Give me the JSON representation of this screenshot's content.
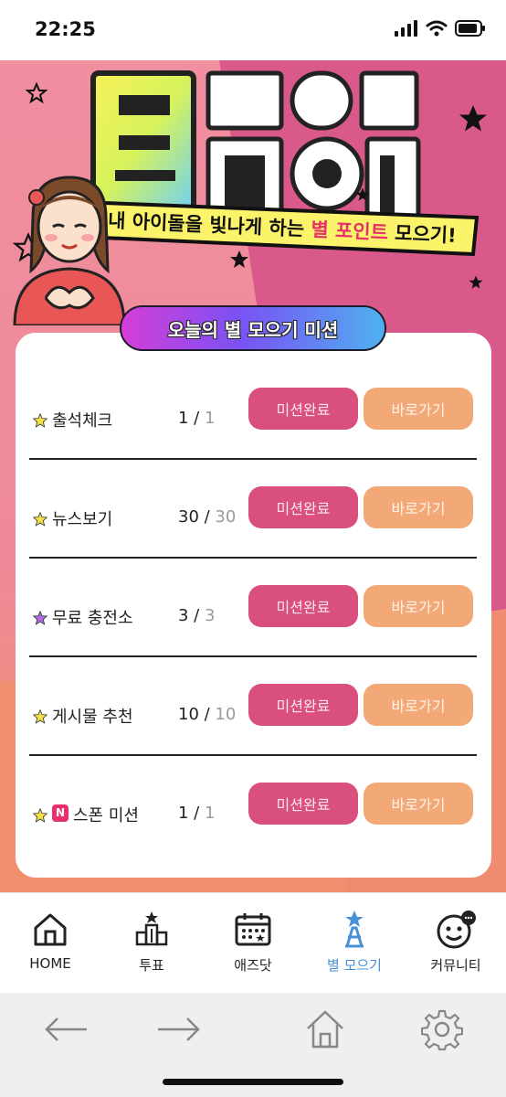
{
  "status": {
    "time": "22:25"
  },
  "hero": {
    "banner_prefix": "내 아이돌을 빛나게 하는",
    "banner_highlight": "별 포인트",
    "banner_suffix": "모으기!",
    "mission_label": "오늘의 별 모으기 미션"
  },
  "missions": [
    {
      "name": "출석체크",
      "current": "1",
      "total": "1",
      "done_label": "미션완료",
      "go_label": "바로가기",
      "star_color": "#f5e04a"
    },
    {
      "name": "뉴스보기",
      "current": "30",
      "total": "30",
      "done_label": "미션완료",
      "go_label": "바로가기",
      "star_color": "#f5e04a"
    },
    {
      "name": "무료 충전소",
      "current": "3",
      "total": "3",
      "done_label": "미션완료",
      "go_label": "바로가기",
      "star_color": "#b06be0"
    },
    {
      "name": "게시물 추천",
      "current": "10",
      "total": "10",
      "done_label": "미션완료",
      "go_label": "바로가기",
      "star_color": "#f5e04a"
    },
    {
      "name": "스폰 미션",
      "badge": "N",
      "current": "1",
      "total": "1",
      "done_label": "미션완료",
      "go_label": "바로가기",
      "star_color": "#f5e04a"
    }
  ],
  "tabs": [
    {
      "label": "HOME",
      "icon": "home-icon"
    },
    {
      "label": "투표",
      "icon": "vote-building-icon"
    },
    {
      "label": "애즈닷",
      "icon": "calendar-icon"
    },
    {
      "label": "별 모으기",
      "icon": "star-tower-icon",
      "active": true
    },
    {
      "label": "커뮤니티",
      "icon": "smiley-chat-icon"
    }
  ],
  "colors": {
    "accent": "#d94f7d",
    "go_button": "#f2a877",
    "active_tab": "#4a90d9"
  }
}
